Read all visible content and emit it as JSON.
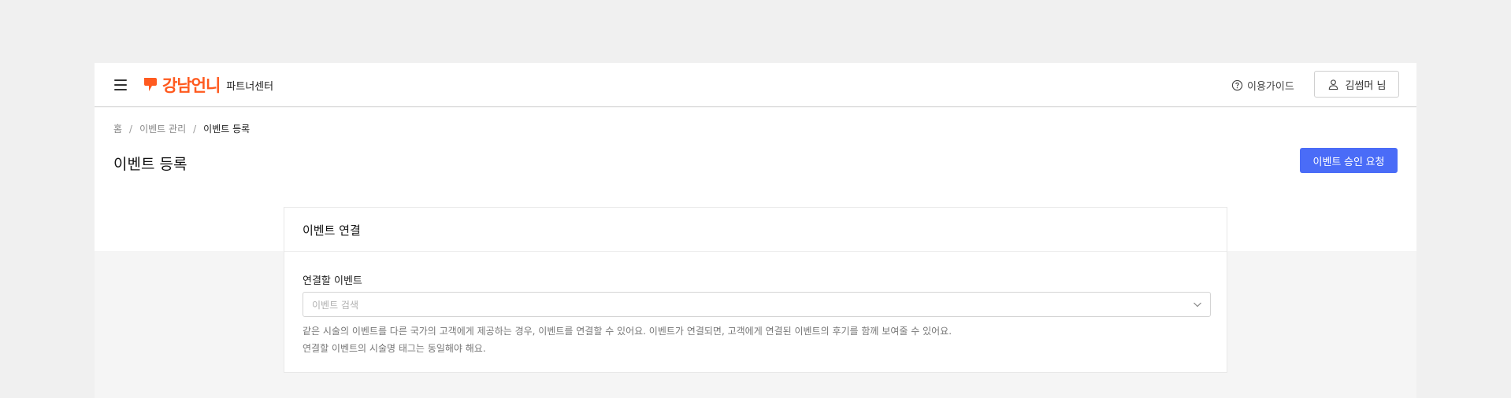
{
  "header": {
    "logo_text": "강남언니",
    "logo_sub": "파트너센터",
    "guide_label": "이용가이드",
    "user_label": "김썸머 님"
  },
  "breadcrumb": {
    "items": [
      "홈",
      "이벤트 관리",
      "이벤트 등록"
    ],
    "separator": "/"
  },
  "page": {
    "title": "이벤트 등록",
    "approve_button": "이벤트 승인 요청"
  },
  "card": {
    "title": "이벤트 연결",
    "field_label": "연결할 이벤트",
    "select_placeholder": "이벤트 검색",
    "help_line1": "같은 시술의 이벤트를 다른 국가의 고객에게 제공하는 경우, 이벤트를 연결할 수 있어요. 이벤트가 연결되면, 고객에게 연결된 이벤트의 후기를 함께 보여줄 수 있어요.",
    "help_line2": "연결할 이벤트의 시술명 태그는 동일해야 해요."
  },
  "colors": {
    "brand": "#ff5a1f",
    "primary": "#4a6cf7"
  },
  "icons": [
    "menu-icon",
    "brand-logo-icon",
    "help-circle-icon",
    "user-icon",
    "chevron-down-icon"
  ]
}
